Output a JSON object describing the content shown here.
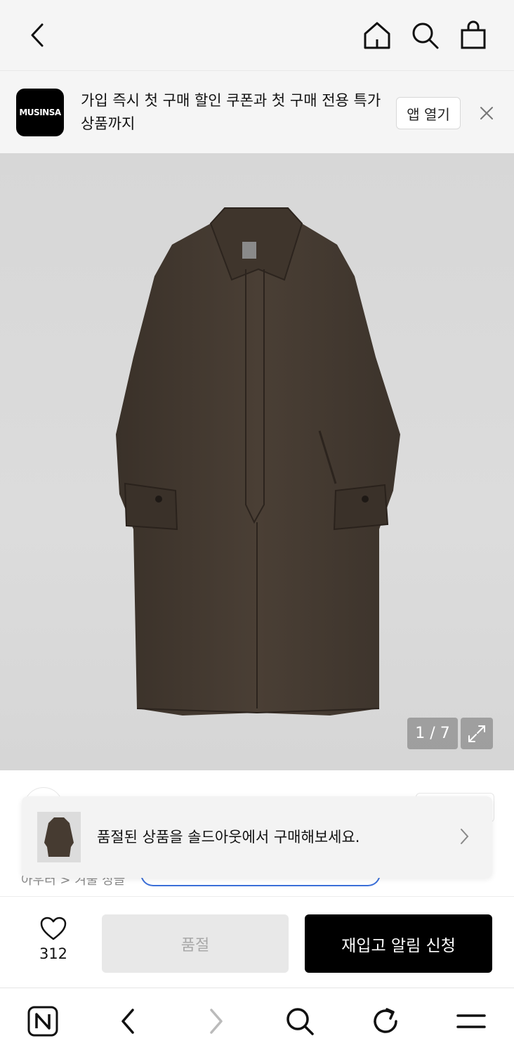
{
  "topbar": {
    "back_icon": "chevron-left-icon",
    "home_icon": "home-icon",
    "search_icon": "search-icon",
    "cart_icon": "shopping-bag-icon"
  },
  "banner": {
    "logo_text": "MUSINSA",
    "message": "가입 즉시 첫 구매 할인 쿠폰과 첫 구매 전용 특가 상품까지",
    "open_app_label": "앱 열기",
    "close_icon": "close-icon"
  },
  "gallery": {
    "counter": "1 / 7",
    "expand_icon": "expand-icon"
  },
  "behind_text": {
    "breadcrumb": "아우터 > 겨울 싱글"
  },
  "toast": {
    "message": "품절된 상품을 솔드아웃에서 구매해보세요.",
    "chevron_icon": "chevron-right-icon"
  },
  "action_bar": {
    "like_icon": "heart-icon",
    "like_count": "312",
    "soldout_label": "품절",
    "restock_label": "재입고 알림 신청"
  },
  "browser_bar": {
    "icons": [
      "naver-icon",
      "back-icon",
      "forward-icon",
      "search-icon",
      "refresh-icon",
      "menu-icon"
    ]
  },
  "colors": {
    "primary_button": "#000000",
    "disabled_button": "#e8e8e8",
    "banner_bg": "#f5f5f5"
  }
}
